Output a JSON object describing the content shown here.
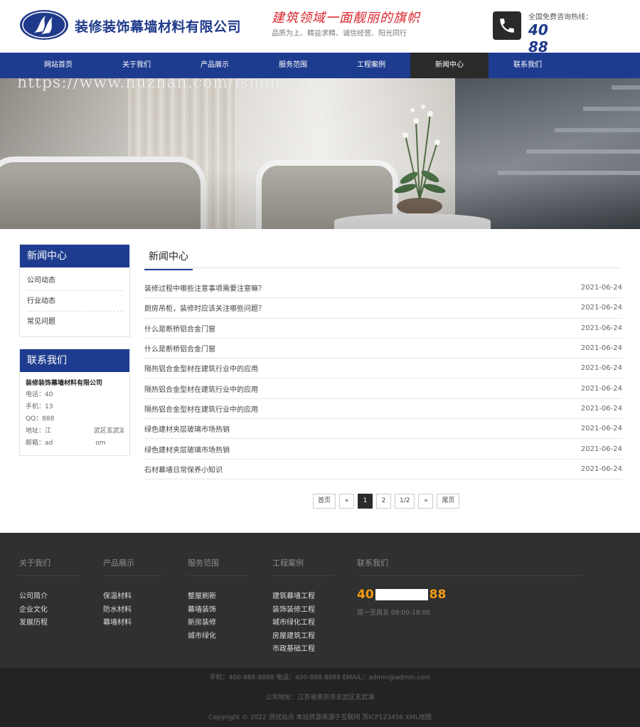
{
  "header": {
    "company_name": "装修装饰幕墙材料有限公司",
    "slogan_main": "建筑领域一面靓丽的旗帜",
    "slogan_sub": "品质为上、精益求精、诚信经营、阳光同行",
    "hotline_label": "全国免费咨询热线：",
    "hotline_start": "40",
    "hotline_end": "88"
  },
  "nav": {
    "items": [
      "网站首页",
      "关于我们",
      "产品展示",
      "服务范围",
      "工程案例",
      "新闻中心",
      "联系我们"
    ],
    "active": "新闻中心"
  },
  "banner": {
    "watermark": "https://www.huzhan.com/ishop33781"
  },
  "sidebar": {
    "news_title": "新闻中心",
    "categories": [
      "公司动态",
      "行业动态",
      "常见问题"
    ],
    "contact_title": "联系我们",
    "contact_company": "装修装饰幕墙材料有限公司",
    "contact_lines": [
      {
        "a": "电话：40",
        "b": ""
      },
      {
        "a": "手机：13",
        "b": ""
      },
      {
        "a": "QQ：888",
        "b": ""
      },
      {
        "a": "地址：江",
        "b": "武区玄武湖"
      },
      {
        "a": "邮箱：ad",
        "b": "om"
      }
    ]
  },
  "main": {
    "title": "新闻中心",
    "news": [
      {
        "title": "装修过程中哪些注意事项需要注意嘛？",
        "date": "2021-06-24"
      },
      {
        "title": "厨房吊柜，装修时应该关注哪些问题？",
        "date": "2021-06-24"
      },
      {
        "title": "什么是断桥铝合金门窗",
        "date": "2021-06-24"
      },
      {
        "title": "什么是断桥铝合金门窗",
        "date": "2021-06-24"
      },
      {
        "title": "隔热铝合金型材在建筑行业中的应用",
        "date": "2021-06-24"
      },
      {
        "title": "隔热铝合金型材在建筑行业中的应用",
        "date": "2021-06-24"
      },
      {
        "title": "隔热铝合金型材在建筑行业中的应用",
        "date": "2021-06-24"
      },
      {
        "title": "绿色建材夹层玻璃市场热销",
        "date": "2021-06-24"
      },
      {
        "title": "绿色建材夹层玻璃市场热销",
        "date": "2021-06-24"
      },
      {
        "title": "石材幕墙日常保养小知识",
        "date": "2021-06-24"
      }
    ],
    "pager": {
      "first": "首页",
      "prev": "«",
      "page1": "1",
      "page2": "2",
      "info": "1/2",
      "next": "»",
      "last": "尾页"
    }
  },
  "footer": {
    "columns": [
      {
        "title": "关于我们",
        "links": [
          "公司简介",
          "企业文化",
          "发展历程"
        ]
      },
      {
        "title": "产品展示",
        "links": [
          "保温材料",
          "防水材料",
          "幕墙材料"
        ]
      },
      {
        "title": "服务范围",
        "links": [
          "整屋刷新",
          "幕墙装饰",
          "新房装修",
          "城市绿化"
        ]
      },
      {
        "title": "工程案例",
        "links": [
          "建筑幕墙工程",
          "装饰装修工程",
          "城市绿化工程",
          "房屋建筑工程",
          "市政基础工程"
        ]
      }
    ],
    "contact_title": "联系我们",
    "phone_start": "40",
    "phone_end": "88",
    "hours": "周一至周五 09:00-18:00",
    "bottom_lines": [
      "手机：400-888-8888 电话：400-888-8888 EMAIL：admin@admin.com",
      "公司地址：江苏省南京市玄武区玄武湖",
      "Copyright © 2022 测试站点 本站资源来源于互联网 苏ICP123456 XML地图"
    ]
  },
  "colors": {
    "brand_blue": "#1e3c8f",
    "nav_active": "#2b2b2b",
    "slogan_red": "#d9242b",
    "footer_phone": "#f39c12"
  }
}
